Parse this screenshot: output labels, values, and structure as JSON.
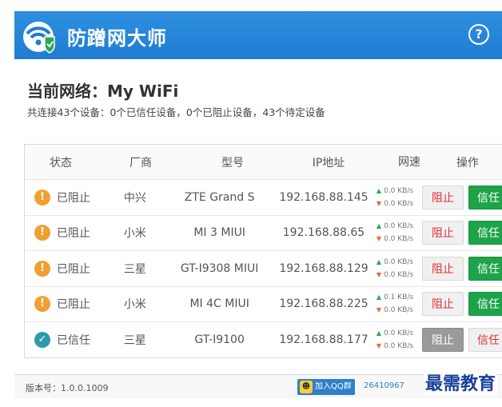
{
  "app": {
    "title": "防蹭网大师",
    "help_label": "?"
  },
  "network": {
    "label": "当前网络：",
    "name": "My WiFi",
    "summary": "共连接43个设备：0个已信任设备，0个已阻止设备，43个待定设备"
  },
  "table": {
    "headers": {
      "status": "状态",
      "vendor": "厂商",
      "model": "型号",
      "ip": "IP地址",
      "speed": "网速",
      "ops": "操作"
    },
    "rows": [
      {
        "status": "已阻止",
        "status_type": "warn",
        "vendor": "中兴",
        "model": "ZTE Grand S",
        "ip": "192.168.88.145",
        "up": "0.0 KB/s",
        "down": "0.0 KB/s",
        "block": "阻止",
        "trust": "信任",
        "block_disabled": false,
        "trust_plain": false
      },
      {
        "status": "已阻止",
        "status_type": "warn",
        "vendor": "小米",
        "model": "MI 3 MIUI",
        "ip": "192.168.88.65",
        "up": "0.0 KB/s",
        "down": "0.0 KB/s",
        "block": "阻止",
        "trust": "信任",
        "block_disabled": false,
        "trust_plain": false
      },
      {
        "status": "已阻止",
        "status_type": "warn",
        "vendor": "三星",
        "model": "GT-I9308 MIUI",
        "ip": "192.168.88.129",
        "up": "0.0 KB/s",
        "down": "0.0 KB/s",
        "block": "阻止",
        "trust": "信任",
        "block_disabled": false,
        "trust_plain": false
      },
      {
        "status": "已阻止",
        "status_type": "warn",
        "vendor": "小米",
        "model": "MI 4C MIUI",
        "ip": "192.168.88.225",
        "up": "0.1 KB/s",
        "down": "0.0 KB/s",
        "block": "阻止",
        "trust": "信任",
        "block_disabled": false,
        "trust_plain": false
      },
      {
        "status": "已信任",
        "status_type": "ok",
        "vendor": "三星",
        "model": "GT-I9100",
        "ip": "192.168.88.177",
        "up": "0.0 KB/s",
        "down": "0.0 KB/s",
        "block": "阻止",
        "trust": "信任",
        "block_disabled": true,
        "trust_plain": true
      }
    ]
  },
  "footer": {
    "version": "版本号：1.0.0.1009",
    "qq_button": "加入QQ群",
    "qq_number": "26410967"
  },
  "watermark": "最需教育",
  "colors": {
    "titlebar": "#2e8fe0",
    "trust_green": "#1fa34a",
    "block_red": "#e03030",
    "warn_orange": "#f0a030",
    "ok_teal": "#2c9ba8"
  }
}
